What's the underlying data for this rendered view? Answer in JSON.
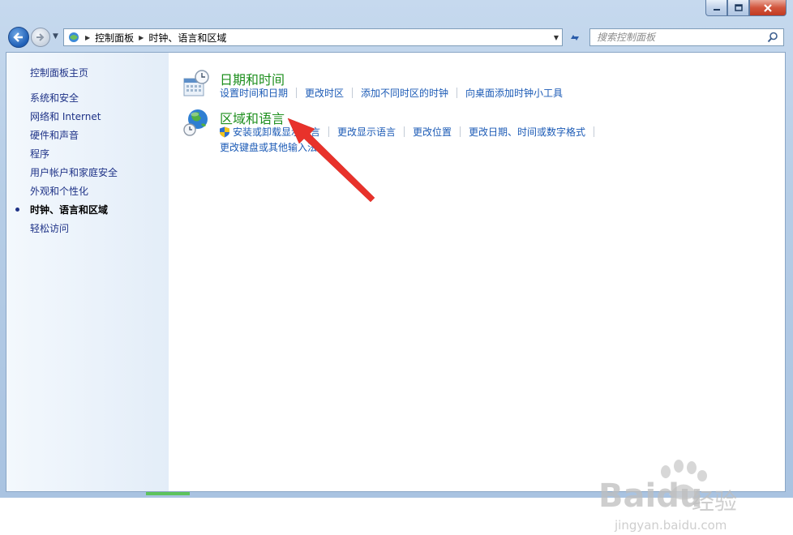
{
  "window": {
    "controls": {
      "minimize_icon": "minimize-icon",
      "maximize_icon": "maximize-icon",
      "close_icon": "close-icon"
    }
  },
  "nav": {
    "breadcrumb": [
      "控制面板",
      "时钟、语言和区域"
    ],
    "search_placeholder": "搜索控制面板"
  },
  "sidebar": {
    "home": "控制面板主页",
    "items": [
      {
        "label": "系统和安全",
        "active": false
      },
      {
        "label": "网络和 Internet",
        "active": false
      },
      {
        "label": "硬件和声音",
        "active": false
      },
      {
        "label": "程序",
        "active": false
      },
      {
        "label": "用户帐户和家庭安全",
        "active": false
      },
      {
        "label": "外观和个性化",
        "active": false
      },
      {
        "label": "时钟、语言和区域",
        "active": true
      },
      {
        "label": "轻松访问",
        "active": false
      }
    ]
  },
  "categories": [
    {
      "title": "日期和时间",
      "icon": "calendar-clock-icon",
      "tasks": [
        "设置时间和日期",
        "更改时区",
        "添加不同时区的时钟",
        "向桌面添加时钟小工具"
      ]
    },
    {
      "title": "区域和语言",
      "icon": "globe-clock-icon",
      "tasks": [
        "安装或卸载显示语言",
        "更改显示语言",
        "更改位置",
        "更改日期、时间或数字格式"
      ],
      "tasks_row2": [
        "更改键盘或其他输入法"
      ]
    }
  ],
  "watermark": {
    "brand": "Bai",
    "brand2": "du",
    "cn": "经验",
    "url": "jingyan.baidu.com"
  },
  "colors": {
    "link": "#1c5bb6",
    "category_title": "#1e8f1e",
    "sidebar_link": "#1e3287",
    "annotation_arrow": "#e8322b"
  }
}
